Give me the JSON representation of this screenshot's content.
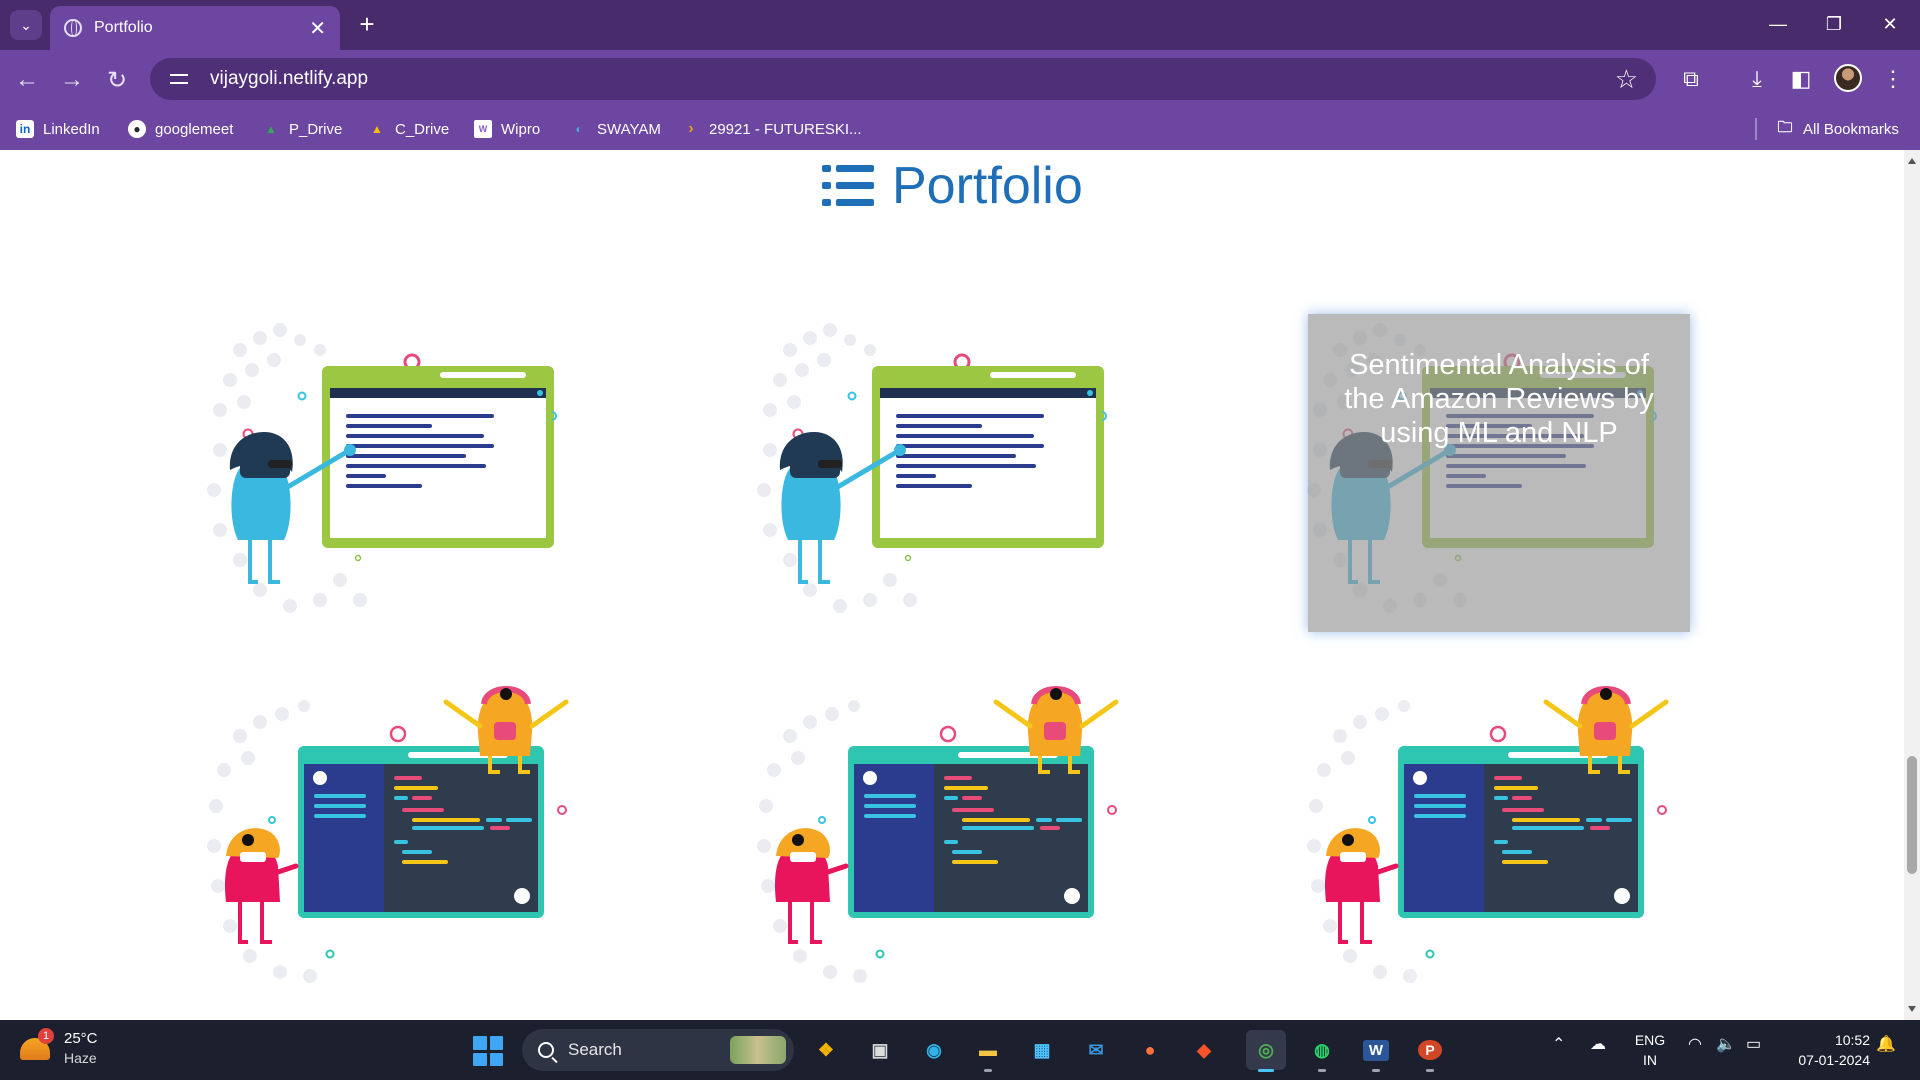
{
  "browser": {
    "tab": {
      "title": "Portfolio",
      "close": "✕"
    },
    "new_tab": "+",
    "window": {
      "minimize": "—",
      "restore": "❐",
      "close": "✕"
    },
    "address": "vijaygoli.netlify.app",
    "bookmarks": [
      {
        "label": "LinkedIn",
        "icon": "in"
      },
      {
        "label": "googlemeet",
        "icon": "github-icon"
      },
      {
        "label": "P_Drive",
        "icon": "drive-icon"
      },
      {
        "label": "C_Drive",
        "icon": "drive-icon"
      },
      {
        "label": "Wipro",
        "icon": "wipro-icon"
      },
      {
        "label": "SWAYAM",
        "icon": "swayam-icon"
      },
      {
        "label": "29921 - FUTURESKI...",
        "icon": "chevron-icon"
      }
    ],
    "all_bookmarks": "All Bookmarks"
  },
  "page": {
    "heading": "Portfolio",
    "overlay_title": "Sentimental Analysis of the Amazon Reviews by using ML and NLP"
  },
  "taskbar": {
    "weather": {
      "temp": "25°C",
      "desc": "Haze",
      "badge": "1"
    },
    "search_placeholder": "Search",
    "lang": {
      "line1": "ENG",
      "line2": "IN"
    },
    "clock": {
      "time": "10:52",
      "date": "07-01-2024"
    }
  },
  "colors": {
    "titlebar": "#472b6a",
    "toolbar": "#6c46a1",
    "heading": "#1e6fb8",
    "taskbar": "#1b1f2e"
  }
}
